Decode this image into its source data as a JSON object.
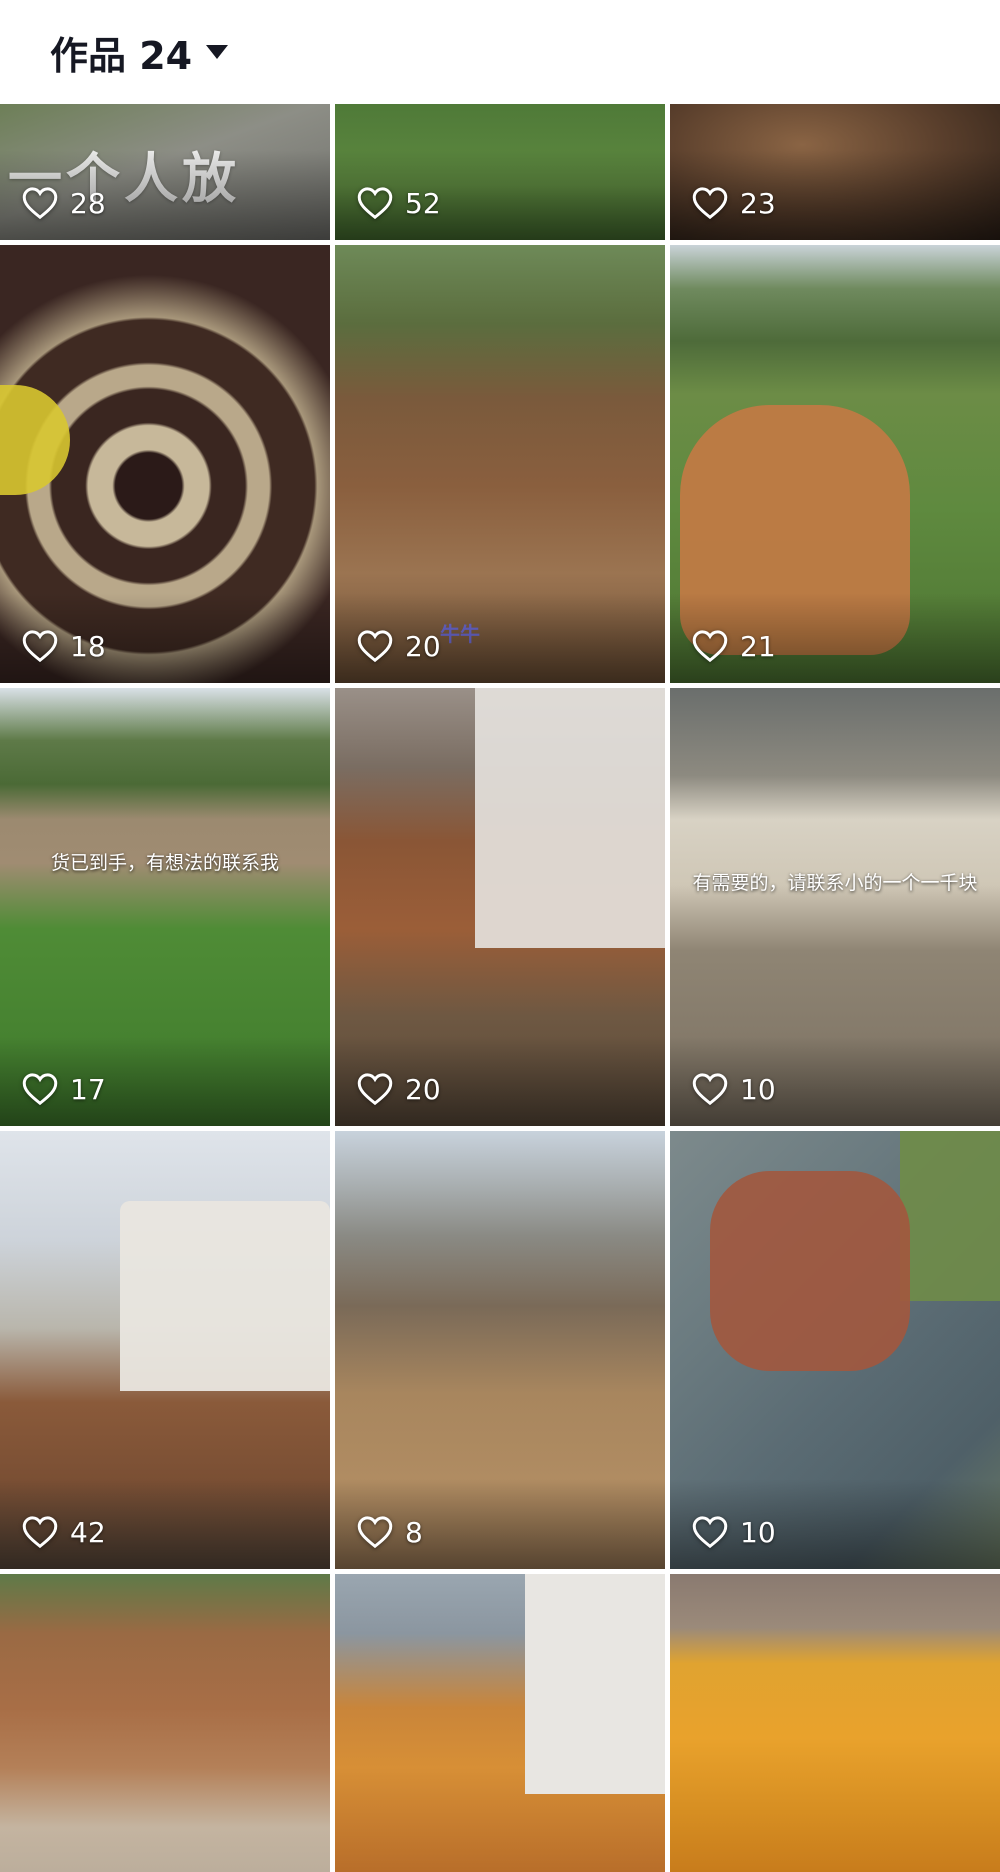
{
  "header": {
    "title": "作品 24"
  },
  "tiles": [
    {
      "likes": "28",
      "overlay": "一个人放"
    },
    {
      "likes": "52"
    },
    {
      "likes": "23"
    },
    {
      "likes": "18"
    },
    {
      "likes": "20",
      "watermark": "牛牛"
    },
    {
      "likes": "21"
    },
    {
      "likes": "17",
      "caption": "货已到手，有想法的联系我"
    },
    {
      "likes": "20"
    },
    {
      "likes": "10",
      "caption": "有需要的，请联系小的一个一千块"
    },
    {
      "likes": "42"
    },
    {
      "likes": "8"
    },
    {
      "likes": "10"
    },
    {},
    {},
    {}
  ],
  "icons": {
    "like": "heart-outline-icon",
    "dropdown": "caret-down-icon"
  }
}
